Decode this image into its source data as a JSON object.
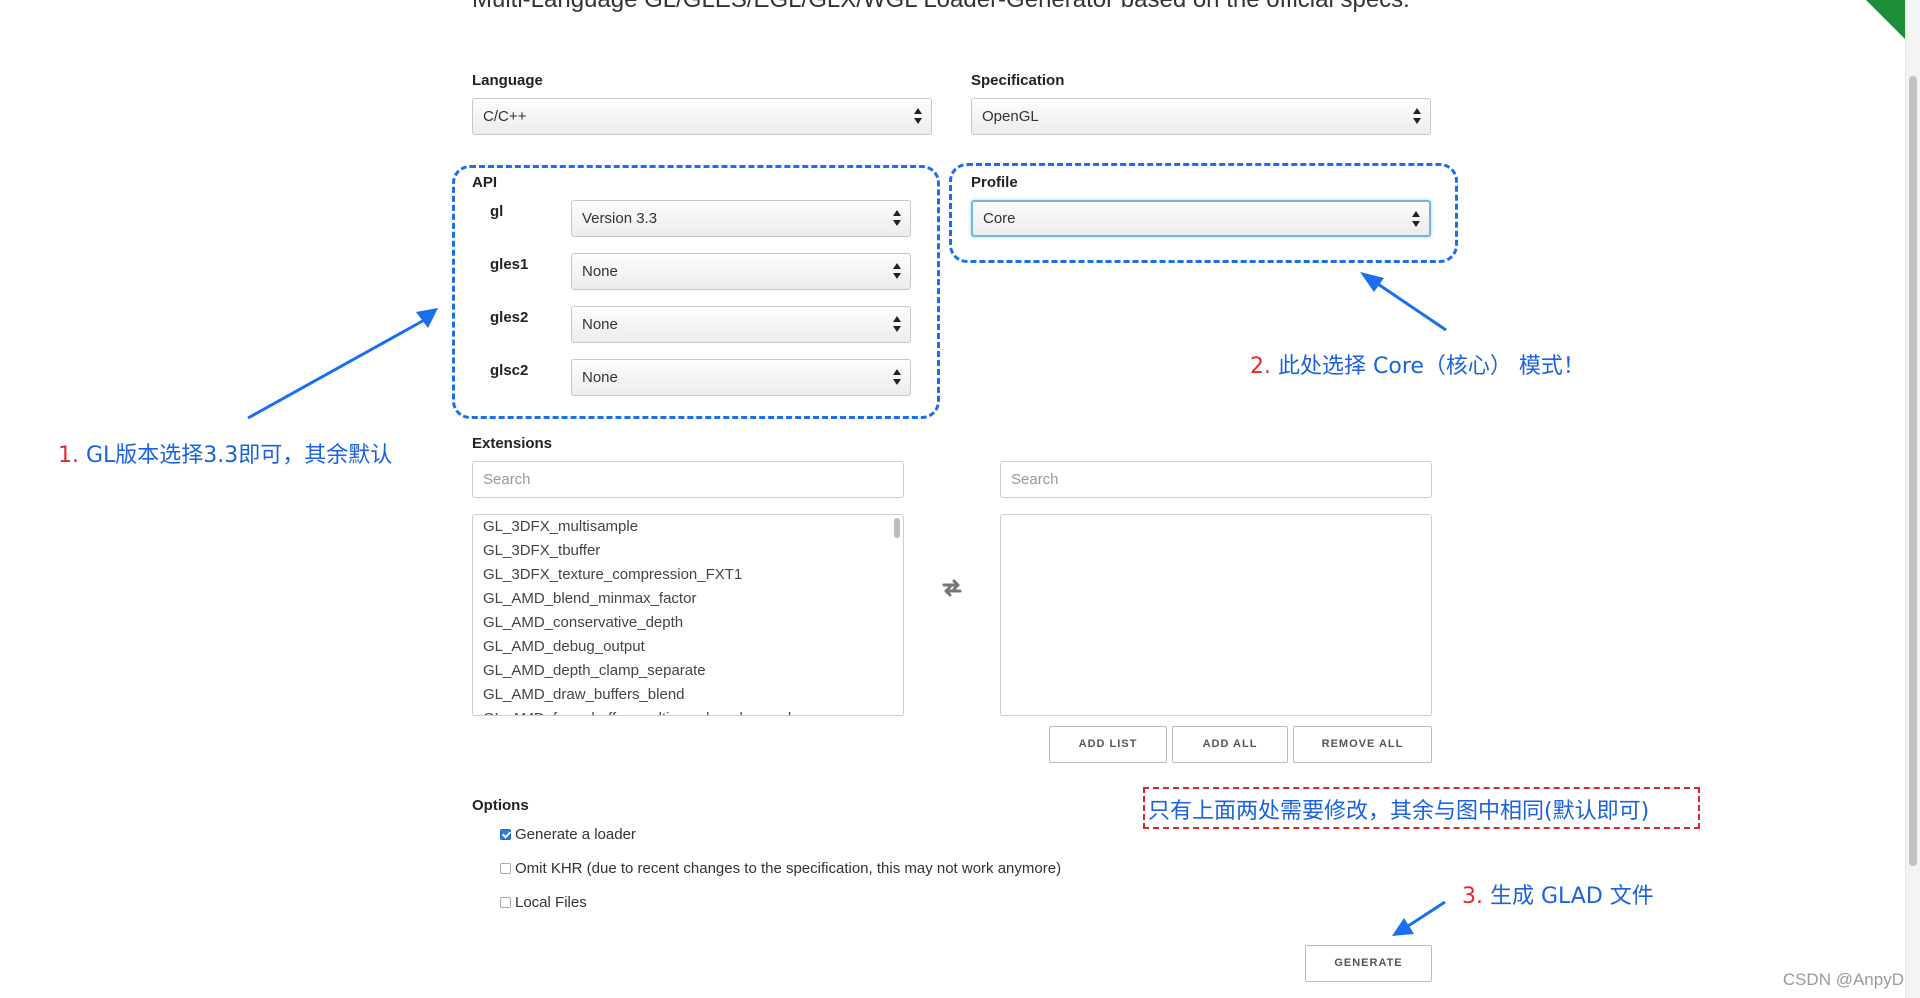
{
  "header": {
    "subtitle": "Multi-Language GL/GLES/EGL/GLX/WGL Loader-Generator based on the official specs."
  },
  "language": {
    "label": "Language",
    "value": "C/C++"
  },
  "specification": {
    "label": "Specification",
    "value": "OpenGL"
  },
  "api": {
    "label": "API",
    "rows": [
      {
        "name": "gl",
        "value": "Version 3.3"
      },
      {
        "name": "gles1",
        "value": "None"
      },
      {
        "name": "gles2",
        "value": "None"
      },
      {
        "name": "glsc2",
        "value": "None"
      }
    ]
  },
  "profile": {
    "label": "Profile",
    "value": "Core"
  },
  "extensions": {
    "label": "Extensions",
    "search_left_placeholder": "Search",
    "search_right_placeholder": "Search",
    "available": [
      "GL_3DFX_multisample",
      "GL_3DFX_tbuffer",
      "GL_3DFX_texture_compression_FXT1",
      "GL_AMD_blend_minmax_factor",
      "GL_AMD_conservative_depth",
      "GL_AMD_debug_output",
      "GL_AMD_depth_clamp_separate",
      "GL_AMD_draw_buffers_blend",
      "GL_AMD_framebuffer_multisample_advanced"
    ],
    "buttons": {
      "add_list": "ADD LIST",
      "add_all": "ADD ALL",
      "remove_all": "REMOVE ALL"
    }
  },
  "options": {
    "label": "Options",
    "items": [
      {
        "label": "Generate a loader",
        "checked": true
      },
      {
        "label": "Omit KHR (due to recent changes to the specification, this may not work anymore)",
        "checked": false
      },
      {
        "label": "Local Files",
        "checked": false
      }
    ]
  },
  "generate_label": "GENERATE",
  "annotations": {
    "a1_num": "1.",
    "a1_text": "GL版本选择3.3即可，其余默认",
    "a2_num": "2.",
    "a2_text": "此处选择 Core（核心） 模式！",
    "a3_num": "3.",
    "a3_text": "生成 GLAD 文件",
    "note": "只有上面两处需要修改，其余与图中相同(默认即可)"
  },
  "watermark": "CSDN @AnpyD",
  "colors": {
    "annotation_blue": "#1a6ef0",
    "annotation_red": "#e0242a",
    "check_blue": "#2a7fe0"
  }
}
